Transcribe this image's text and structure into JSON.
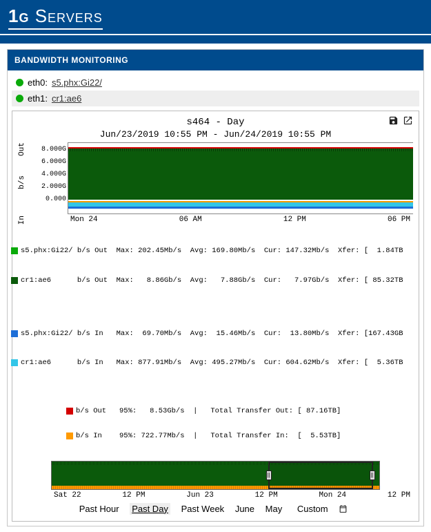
{
  "brand": {
    "prefix": "1g",
    "suffix": " Servers"
  },
  "panel": {
    "title": "BANDWIDTH MONITORING"
  },
  "interfaces": [
    {
      "iface": "eth0",
      "link": "s5.phx:Gi22/"
    },
    {
      "iface": "eth1",
      "link": "cr1:ae6"
    }
  ],
  "chart": {
    "title": "s464 - Day",
    "subtitle": "Jun/23/2019 10:55 PM - Jun/24/2019 10:55 PM",
    "y_label_out": "Out",
    "y_label_mid": "b/s",
    "y_label_in": "In",
    "yticks": [
      "8.000G",
      "6.000G",
      "4.000G",
      "2.000G",
      "0.000"
    ],
    "xticks": [
      "Mon 24",
      "06 AM",
      "12 PM",
      "06 PM"
    ]
  },
  "legend_rows": [
    {
      "sw": "sw-green",
      "text": "s5.phx:Gi22/ b/s Out  Max: 202.45Mb/s  Avg: 169.80Mb/s  Cur: 147.32Mb/s  Xfer: [  1.84TB"
    },
    {
      "sw": "sw-dkgreen",
      "text": "cr1:ae6      b/s Out  Max:   8.86Gb/s  Avg:   7.88Gb/s  Cur:   7.97Gb/s  Xfer: [ 85.32TB"
    },
    {
      "sw": "",
      "text": " "
    },
    {
      "sw": "sw-blue",
      "text": "s5.phx:Gi22/ b/s In   Max:  69.70Mb/s  Avg:  15.46Mb/s  Cur:  13.80Mb/s  Xfer: [167.43GB"
    },
    {
      "sw": "sw-cyan",
      "text": "cr1:ae6      b/s In   Max: 877.91Mb/s  Avg: 495.27Mb/s  Cur: 604.62Mb/s  Xfer: [  5.36TB"
    }
  ],
  "summary_rows": [
    {
      "sw": "sw-red",
      "text": "b/s Out   95%:   8.53Gb/s  |   Total Transfer Out: [ 87.16TB]"
    },
    {
      "sw": "sw-orange",
      "text": "b/s In    95%: 722.77Mb/s  |   Total Transfer In:  [  5.53TB]"
    }
  ],
  "mini_xticks": [
    "Sat 22",
    "12 PM",
    "Jun 23",
    "12 PM",
    "Mon 24",
    "12 PM"
  ],
  "ranges": {
    "items": [
      "Past Hour",
      "Past Day",
      "Past Week",
      "June",
      "May",
      "Custom"
    ],
    "active": "Past Day"
  },
  "chart_data": {
    "type": "area",
    "title": "s464 - Day",
    "x_range": [
      "2019-06-23T22:55",
      "2019-06-24T22:55"
    ],
    "xlabel": "",
    "ylabel": "b/s",
    "ylim_out": [
      0,
      9000000000
    ],
    "ylim_in": [
      0,
      1000000000
    ],
    "series": [
      {
        "name": "s5.phx:Gi22/ Out",
        "color": "#0aaa0a",
        "max": 202450000,
        "avg": 169800000,
        "cur": 147320000,
        "xfer": "1.84TB"
      },
      {
        "name": "cr1:ae6 Out",
        "color": "#0b5a0b",
        "max": 8860000000,
        "avg": 7880000000,
        "cur": 7970000000,
        "xfer": "85.32TB"
      },
      {
        "name": "s5.phx:Gi22/ In",
        "color": "#1e6fd8",
        "max": 69700000,
        "avg": 15460000,
        "cur": 13800000,
        "xfer": "167.43GB"
      },
      {
        "name": "cr1:ae6 In",
        "color": "#33c6e8",
        "max": 877910000,
        "avg": 495270000,
        "cur": 604620000,
        "xfer": "5.36TB"
      }
    ],
    "percentile95": {
      "out": 8530000000,
      "in": 722770000
    },
    "totals": {
      "out": "87.16TB",
      "in": "5.53TB"
    },
    "overview_range": [
      "2019-06-22",
      "2019-06-25"
    ],
    "overview_viewport": [
      "2019-06-23T22:55",
      "2019-06-24T22:55"
    ]
  }
}
